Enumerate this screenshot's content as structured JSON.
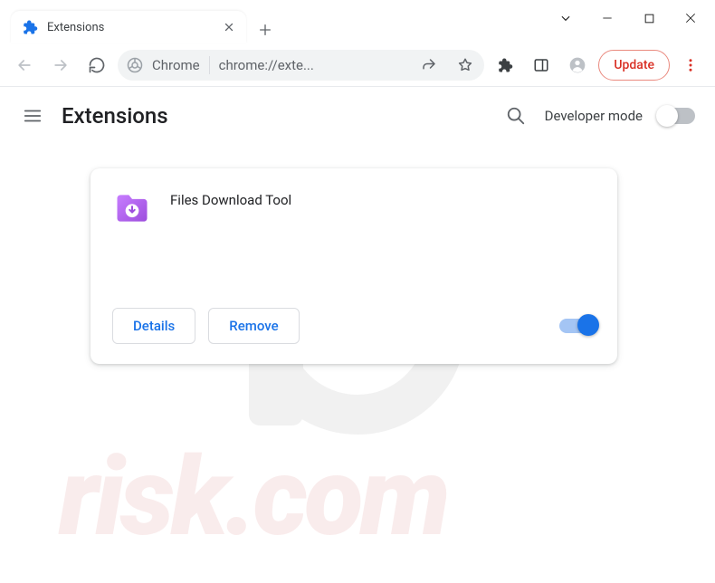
{
  "window": {
    "tab_title": "Extensions",
    "url_label": "Chrome",
    "url_text": "chrome://exte...",
    "update_button": "Update"
  },
  "page": {
    "title": "Extensions",
    "dev_mode_label": "Developer mode",
    "dev_mode_on": false
  },
  "extension": {
    "name": "Files Download Tool",
    "details_button": "Details",
    "remove_button": "Remove",
    "enabled": true
  },
  "watermark_text": "pcrisk.com"
}
